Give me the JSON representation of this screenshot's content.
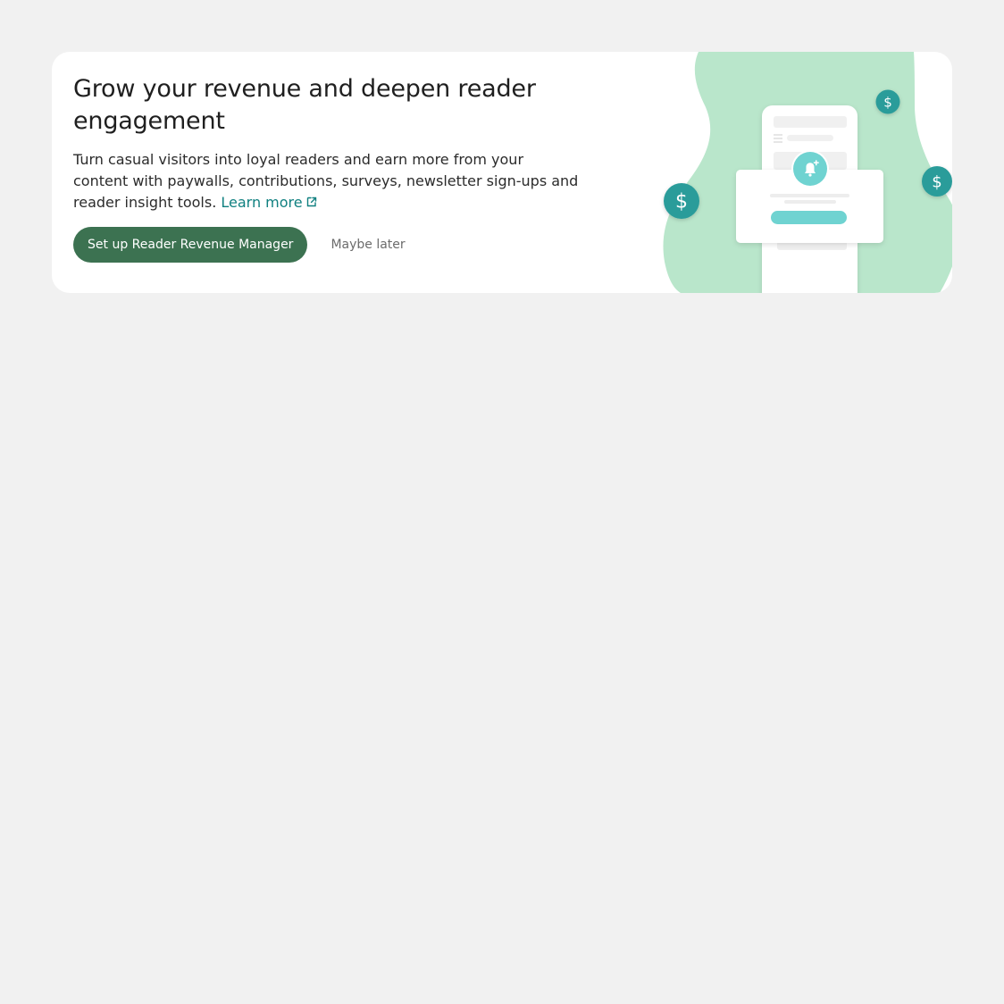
{
  "banner": {
    "title": "Grow your revenue and deepen reader engagement",
    "description": "Turn casual visitors into loyal readers and earn more from your content with paywalls, contributions, surveys, newsletter sign-ups and reader insight tools.",
    "learn_more_label": "Learn more",
    "primary_button_label": "Set up Reader Revenue Manager",
    "secondary_button_label": "Maybe later"
  },
  "illustration": {
    "icons": [
      "dollar-coin-icon",
      "bell-add-icon",
      "external-link-icon"
    ],
    "colors": {
      "blob": "#b9e6cb",
      "coin": "#2c9c9a",
      "bell_circle": "#6fd3d1",
      "accent_bar": "#6fd3d1",
      "placeholder": "#f0f0f0"
    }
  },
  "colors": {
    "page_background": "#f1f1f1",
    "card_background": "#ffffff",
    "primary_button": "#3c7251",
    "link": "#108080"
  }
}
